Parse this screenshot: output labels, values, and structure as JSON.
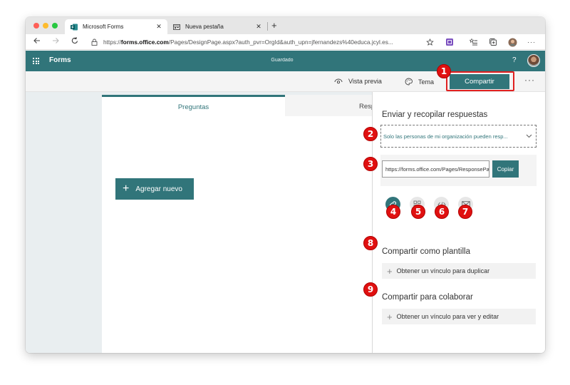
{
  "browser": {
    "tabs": [
      {
        "title": "Microsoft Forms",
        "close": "✕",
        "active": true
      },
      {
        "title": "Nueva pestaña",
        "close": "✕",
        "active": false
      }
    ],
    "new_tab": "+",
    "url_prefix": "https://",
    "url_domain": "forms.office.com",
    "url_rest": "/Pages/DesignPage.aspx?auth_pvr=OrgId&auth_upn=jfernandezs%40educa.jcyl.es...",
    "more": "···"
  },
  "appbar": {
    "app_name": "Forms",
    "save_status": "Guardado",
    "help": "?"
  },
  "toolbar": {
    "preview_label": "Vista previa",
    "theme_label": "Tema",
    "share_label": "Compartir",
    "more": "···"
  },
  "form": {
    "tabs": [
      "Preguntas",
      "Respuestas"
    ],
    "add_new_label": "Agregar nuevo",
    "add_new_icon": "+"
  },
  "share_panel": {
    "send_heading": "Enviar y recopilar respuestas",
    "audience_value": "Solo las personas de mi organización pueden resp...",
    "link_value": "https://forms.office.com/Pages/ResponsePage.aspx",
    "copy_label": "Copiar",
    "share_options": [
      "link-icon",
      "qr-code-icon",
      "embed-code-icon",
      "email-icon"
    ],
    "template_heading": "Compartir como plantilla",
    "template_link_label": "Obtener un vínculo para duplicar",
    "collab_heading": "Compartir para colaborar",
    "collab_link_label": "Obtener un vínculo para ver y editar"
  },
  "badges": [
    "1",
    "2",
    "3",
    "4",
    "5",
    "6",
    "7",
    "8",
    "9"
  ],
  "colors": {
    "accent": "#31757a",
    "badge": "#e01010"
  }
}
